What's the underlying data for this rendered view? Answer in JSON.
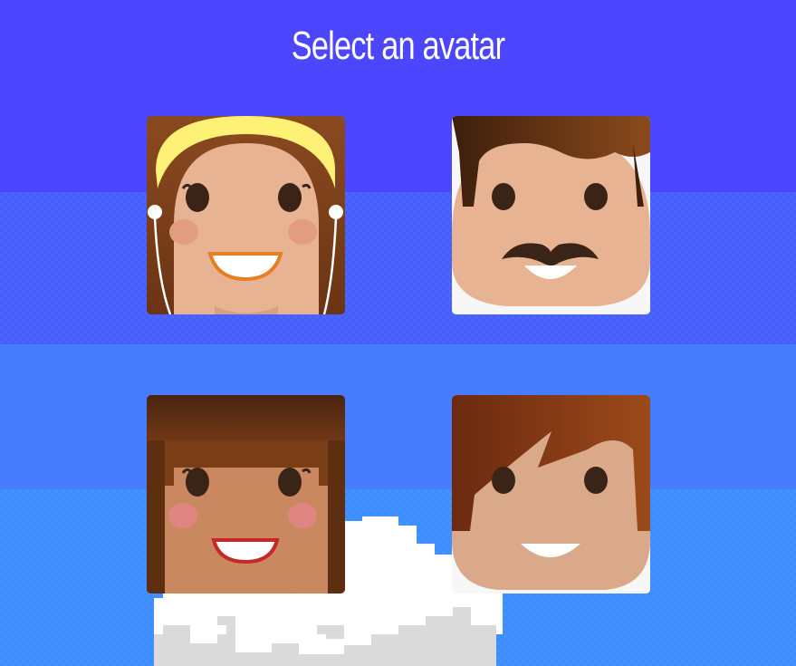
{
  "header": {
    "title": "Select an avatar"
  },
  "avatars": [
    {
      "name": "blonde-girl-with-earphones"
    },
    {
      "name": "man-with-mustache"
    },
    {
      "name": "dark-haired-girl"
    },
    {
      "name": "red-haired-boy"
    }
  ],
  "colors": {
    "sky_top": "#4c47ff",
    "sky_mid": "#477cff",
    "sky_bottom": "#3f8cff",
    "cloud": "#ffffff",
    "cloud_shadow": "#d9d9d9"
  }
}
